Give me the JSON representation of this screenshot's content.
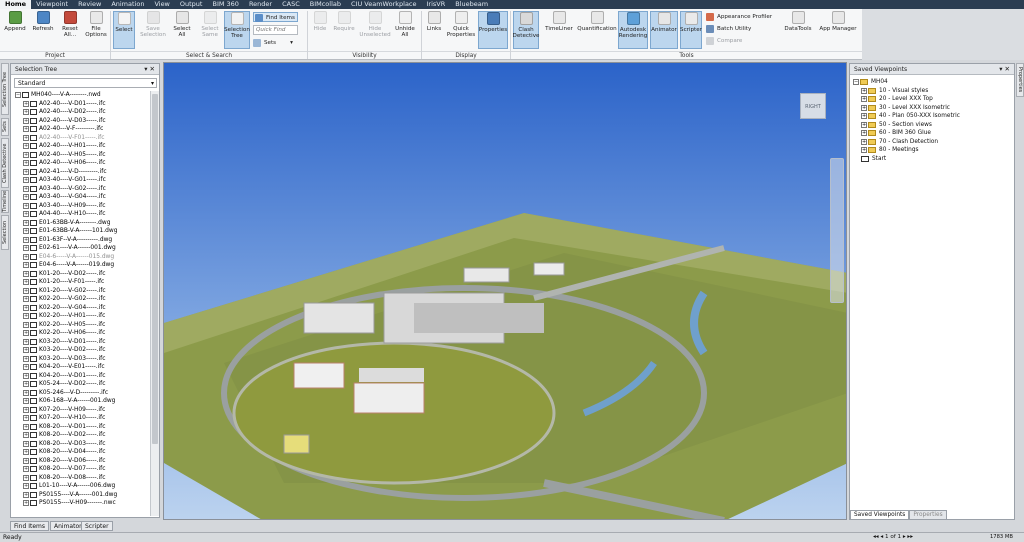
{
  "menubar": {
    "tabs": [
      "Home",
      "Viewpoint",
      "Review",
      "Animation",
      "View",
      "Output",
      "BIM 360",
      "Render",
      "CASC",
      "BIMcollab",
      "CIU VeamWorkplace",
      "IrisVR",
      "Bluebeam"
    ]
  },
  "ribbon": {
    "project": {
      "append": "Append",
      "refresh": "Refresh",
      "reset_all": "Reset All...",
      "file_options": "File Options",
      "group": "Project"
    },
    "select_search": {
      "select": "Select",
      "save_selection": "Save Selection",
      "select_all": "Select All",
      "select_same": "Select Same",
      "selection_tree": "Selection Tree",
      "find_items": "Find Items",
      "quick_find_placeholder": "Quick Find",
      "sets": "Sets",
      "group": "Select & Search"
    },
    "visibility": {
      "hide": "Hide",
      "require": "Require",
      "hide_unselected": "Hide Unselected",
      "unhide_all": "Unhide All",
      "group": "Visibility"
    },
    "display": {
      "links": "Links",
      "quick_properties": "Quick Properties",
      "properties": "Properties",
      "group": "Display"
    },
    "tools": {
      "clash_detective": "Clash Detective",
      "timeliner": "TimeLiner",
      "quantification": "Quantification",
      "autodesk_rendering": "Autodesk Rendering",
      "animator": "Animator",
      "scripter": "Scripter",
      "appearance_profiler": "Appearance Profiler",
      "batch_utility": "Batch Utility",
      "compare": "Compare",
      "datatools": "DataTools",
      "app_manager": "App Manager",
      "group": "Tools"
    }
  },
  "selection_tree": {
    "title": "Selection Tree",
    "dropdown_value": "Standard",
    "root": "MH040----V-A--------.nwd",
    "items": [
      {
        "label": "A02-40----V-D01-----.ifc",
        "dim": false
      },
      {
        "label": "A02-40----V-D02-----.ifc",
        "dim": false
      },
      {
        "label": "A02-40----V-D03-----.ifc",
        "dim": false
      },
      {
        "label": "A02-40---V-F---------.ifc",
        "dim": false
      },
      {
        "label": "A02-40----V-F01-----.ifc",
        "dim": true
      },
      {
        "label": "A02-40----V-H01-----.ifc",
        "dim": false
      },
      {
        "label": "A02-40----V-H05-----.ifc",
        "dim": false
      },
      {
        "label": "A02-40----V-H06-----.ifc",
        "dim": false
      },
      {
        "label": "A02-41----V-D---------.ifc",
        "dim": false
      },
      {
        "label": "A03-40----V-G01-----.ifc",
        "dim": false
      },
      {
        "label": "A03-40----V-G02-----.ifc",
        "dim": false
      },
      {
        "label": "A03-40----V-G04-----.ifc",
        "dim": false
      },
      {
        "label": "A03-40----V-H09-----.ifc",
        "dim": false
      },
      {
        "label": "A04-40----V-H10-----.ifc",
        "dim": false
      },
      {
        "label": "E01-63BB-V-A--------.dwg",
        "dim": false
      },
      {
        "label": "E01-63BB-V-A------101.dwg",
        "dim": false
      },
      {
        "label": "E01-63F--V-A----------.dwg",
        "dim": false
      },
      {
        "label": "E02-61----V-A------001.dwg",
        "dim": false
      },
      {
        "label": "E04-6-----V-A------015.dwg",
        "dim": true
      },
      {
        "label": "E04-6-----V-A------019.dwg",
        "dim": false
      },
      {
        "label": "K01-20----V-D02-----.ifc",
        "dim": false
      },
      {
        "label": "K01-20----V-F01-----.ifc",
        "dim": false
      },
      {
        "label": "K01-20----V-G02-----.ifc",
        "dim": false
      },
      {
        "label": "K02-20----V-G02-----.ifc",
        "dim": false
      },
      {
        "label": "K02-20----V-G04-----.ifc",
        "dim": false
      },
      {
        "label": "K02-20----V-H01-----.ifc",
        "dim": false
      },
      {
        "label": "K02-20----V-H05-----.ifc",
        "dim": false
      },
      {
        "label": "K02-20----V-H06-----.ifc",
        "dim": false
      },
      {
        "label": "K03-20----V-D01-----.ifc",
        "dim": false
      },
      {
        "label": "K03-20----V-D02-----.ifc",
        "dim": false
      },
      {
        "label": "K03-20----V-D03-----.ifc",
        "dim": false
      },
      {
        "label": "K04-20----V-E01-----.ifc",
        "dim": false
      },
      {
        "label": "K04-20----V-D01-----.ifc",
        "dim": false
      },
      {
        "label": "K05-24----V-D02-----.ifc",
        "dim": false
      },
      {
        "label": "K05-246---V-D---------.ifc",
        "dim": false
      },
      {
        "label": "K06-168--V-A------001.dwg",
        "dim": false
      },
      {
        "label": "K07-20----V-H09-----.ifc",
        "dim": false
      },
      {
        "label": "K07-20----V-H10-----.ifc",
        "dim": false
      },
      {
        "label": "K08-20----V-D01-----.ifc",
        "dim": false
      },
      {
        "label": "K08-20----V-D02-----.ifc",
        "dim": false
      },
      {
        "label": "K08-20----V-D03-----.ifc",
        "dim": false
      },
      {
        "label": "K08-20----V-D04-----.ifc",
        "dim": false
      },
      {
        "label": "K08-20----V-D06-----.ifc",
        "dim": false
      },
      {
        "label": "K08-20----V-D07-----.ifc",
        "dim": false
      },
      {
        "label": "K08-20----V-D08-----.ifc",
        "dim": false
      },
      {
        "label": "L01-10----V-A------006.dwg",
        "dim": false
      },
      {
        "label": "PS0155----V-A------001.dwg",
        "dim": false
      },
      {
        "label": "PS0155----V-H09-------.nwc",
        "dim": false
      }
    ]
  },
  "saved_viewpoints": {
    "title": "Saved Viewpoints",
    "root": "MH04",
    "items": [
      "10 - Visual styles",
      "20 - Level XXX Top",
      "30 - Level XXX Isometric",
      "40 - Plan 050-XXX Isometric",
      "50 - Section views",
      "60 - BIM 360 Glue",
      "70 - Clash Detection",
      "80 - Meetings"
    ],
    "start": "Start",
    "tabs": [
      "Saved Viewpoints",
      "Properties"
    ]
  },
  "left_vtabs": [
    "Selection Tree",
    "Sets",
    "Clash Detective",
    "Timeliner",
    "Selection Inspector"
  ],
  "right_vtabs": [
    "Properties"
  ],
  "bottom_tabs": [
    "Find Items",
    "Animator",
    "Scripter"
  ],
  "status": {
    "left": "Ready",
    "page": "1 of 1",
    "memory": "1783 MB"
  },
  "viewcube_label": "RIGHT",
  "colors": {
    "accent": "#7da7cf",
    "menubar": "#2b3d52",
    "sky_top": "#2b63c9",
    "sky_bottom": "#bcd3ef",
    "terrain": "#8c9b4a"
  }
}
